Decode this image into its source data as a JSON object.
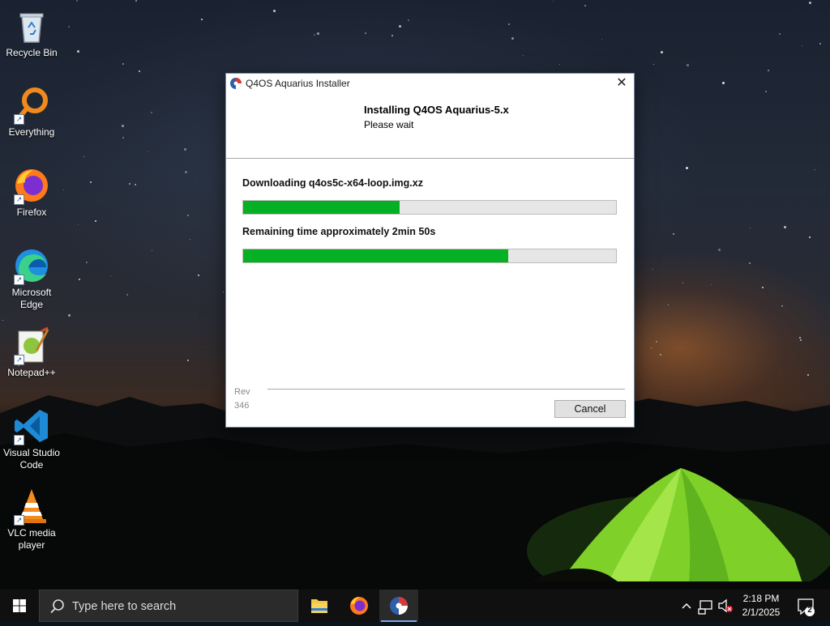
{
  "desktop": {
    "icons": [
      {
        "label": "Recycle Bin",
        "icon": "recycle-bin-icon"
      },
      {
        "label": "Everything",
        "icon": "everything-search-icon"
      },
      {
        "label": "Firefox",
        "icon": "firefox-icon"
      },
      {
        "label": "Microsoft Edge",
        "icon": "edge-icon"
      },
      {
        "label": "Notepad++",
        "icon": "notepad-plus-plus-icon"
      },
      {
        "label": "Visual Studio Code",
        "icon": "vscode-icon"
      },
      {
        "label": "VLC media player",
        "icon": "vlc-icon"
      }
    ]
  },
  "installer": {
    "window_title": "Q4OS Aquarius Installer",
    "header_title": "Installing Q4OS Aquarius-5.x",
    "header_subtitle": "Please wait",
    "download_text": "Downloading q4os5c-x64-loop.img.xz",
    "download_progress": 0.42,
    "remaining_text": "Remaining time approximately 2min 50s",
    "overall_progress": 0.71,
    "rev_label": "Rev",
    "rev_number": "346",
    "cancel_label": "Cancel",
    "close_glyph": "✕",
    "progress_color": "#06b025"
  },
  "taskbar": {
    "search_placeholder": "Type here to search",
    "apps": [
      "file-explorer-icon",
      "firefox-icon",
      "q4os-installer-icon"
    ],
    "clock_time": "2:18 PM",
    "clock_date": "2/1/2025",
    "notification_count": "2"
  }
}
